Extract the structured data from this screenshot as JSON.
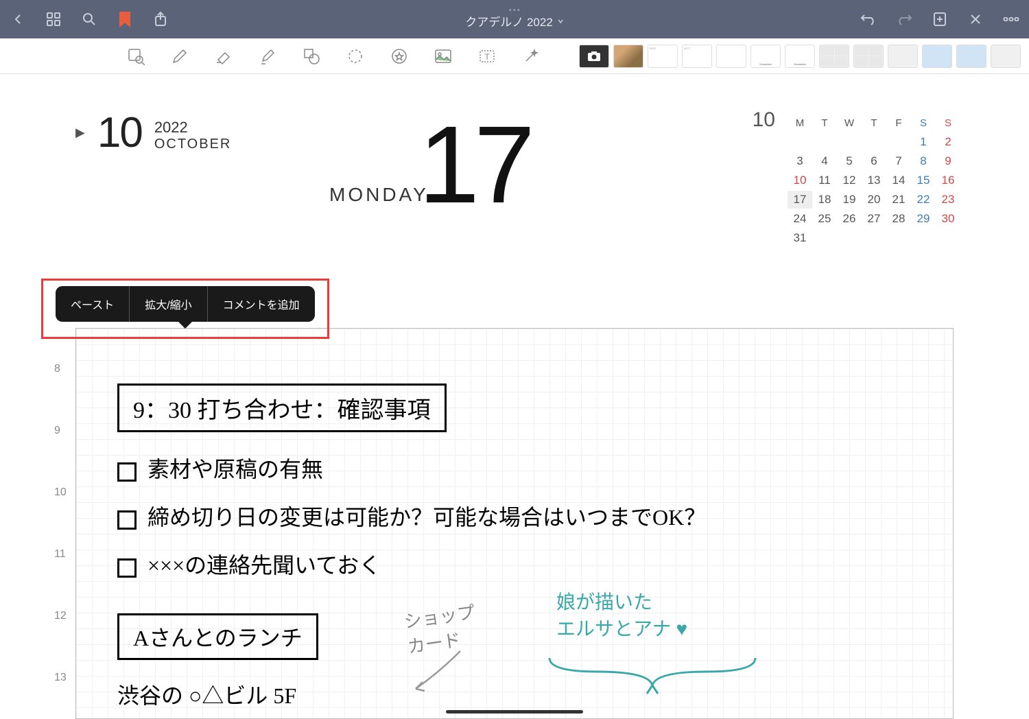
{
  "topbar": {
    "title": "クアデルノ 2022"
  },
  "context_menu": {
    "paste": "ペースト",
    "zoom": "拡大/縮小",
    "add_comment": "コメントを追加"
  },
  "date": {
    "month_num": "10",
    "year": "2022",
    "month_name": "OCTOBER",
    "day_name": "MONDAY",
    "day_num": "17"
  },
  "mini_cal": {
    "month": "10",
    "daynames": [
      "M",
      "T",
      "W",
      "T",
      "F",
      "S",
      "S"
    ],
    "weeks": [
      [
        "",
        "",
        "",
        "",
        "",
        "1",
        "2"
      ],
      [
        "3",
        "4",
        "5",
        "6",
        "7",
        "8",
        "9"
      ],
      [
        "10",
        "11",
        "12",
        "13",
        "14",
        "15",
        "16"
      ],
      [
        "17",
        "18",
        "19",
        "20",
        "21",
        "22",
        "23"
      ],
      [
        "24",
        "25",
        "26",
        "27",
        "28",
        "29",
        "30"
      ],
      [
        "31",
        "",
        "",
        "",
        "",
        "",
        ""
      ]
    ],
    "today": "17",
    "holiday": "10"
  },
  "times": {
    "t8": "8",
    "t9": "9",
    "t10": "10",
    "t11": "11",
    "t12": "12",
    "t13": "13"
  },
  "notes": {
    "line1": "9：30 打ち合わせ：確認事項",
    "line2": "素材や原稿の有無",
    "line3": "締め切り日の変更は可能か？可能な場合はいつまでOK？",
    "line4": "×××の連絡先聞いておく",
    "line5": "Aさんとのランチ",
    "line6": "渋谷の ○△ビル 5F",
    "grey1": "ショップ",
    "grey2": "カード",
    "teal1": "娘が描いた",
    "teal2": "エルサとアナ ♥"
  },
  "thumbs": {
    "sched": "Scheduler"
  }
}
